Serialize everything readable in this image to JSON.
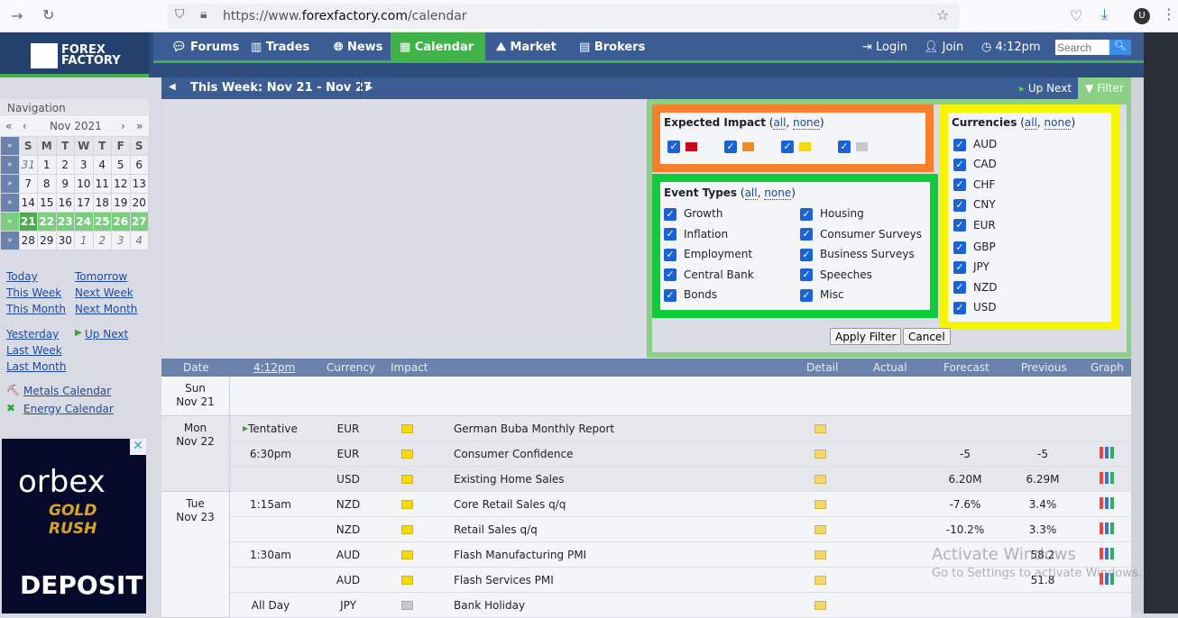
{
  "browser": {
    "url_prefix": "https://www.",
    "url_domain": "forexfactory.com",
    "url_path": "/calendar"
  },
  "header": {
    "logo": "FOREX FACTORY",
    "nav": [
      "Forums",
      "Trades",
      "News",
      "Calendar",
      "Market",
      "Brokers"
    ],
    "active": "Calendar",
    "login": "Login",
    "join": "Join",
    "time": "4:12pm",
    "search_placeholder": "Search"
  },
  "weekbar": {
    "label": "This Week: Nov 21 - Nov 27",
    "up_next": "Up Next",
    "filter": "Filter"
  },
  "sidebar": {
    "title": "Navigation",
    "month": "Nov 2021",
    "days": [
      "S",
      "M",
      "T",
      "W",
      "T",
      "F",
      "S"
    ],
    "weeks": [
      [
        "31",
        "1",
        "2",
        "3",
        "4",
        "5",
        "6"
      ],
      [
        "7",
        "8",
        "9",
        "10",
        "11",
        "12",
        "13"
      ],
      [
        "14",
        "15",
        "16",
        "17",
        "18",
        "19",
        "20"
      ],
      [
        "21",
        "22",
        "23",
        "24",
        "25",
        "26",
        "27"
      ],
      [
        "28",
        "29",
        "30",
        "1",
        "2",
        "3",
        "4"
      ]
    ],
    "links": {
      "today": "Today",
      "tomorrow": "Tomorrow",
      "this_week": "This Week",
      "next_week": "Next Week",
      "this_month": "This Month",
      "next_month": "Next Month",
      "yesterday": "Yesterday",
      "up_next": "Up Next",
      "last_week": "Last Week",
      "last_month": "Last Month",
      "metals": "Metals Calendar",
      "energy": "Energy Calendar"
    }
  },
  "filter": {
    "impact_title": "Expected Impact",
    "all": "all",
    "none": "none",
    "impact_colors": [
      "#d0021b",
      "#f08a24",
      "#f5d90a",
      "#c8c8c8"
    ],
    "event_title": "Event Types",
    "events_left": [
      "Growth",
      "Inflation",
      "Employment",
      "Central Bank",
      "Bonds"
    ],
    "events_right": [
      "Housing",
      "Consumer Surveys",
      "Business Surveys",
      "Speeches",
      "Misc"
    ],
    "currency_title": "Currencies",
    "currencies": [
      "AUD",
      "CAD",
      "CHF",
      "CNY",
      "EUR",
      "GBP",
      "JPY",
      "NZD",
      "USD"
    ],
    "apply": "Apply Filter",
    "cancel": "Cancel"
  },
  "table": {
    "headers": {
      "date": "Date",
      "time": "4:12pm",
      "currency": "Currency",
      "impact": "Impact",
      "detail": "Detail",
      "actual": "Actual",
      "forecast": "Forecast",
      "previous": "Previous",
      "graph": "Graph"
    },
    "days": [
      {
        "day": "Sun",
        "date": "Nov 21"
      },
      {
        "day": "Mon",
        "date": "Nov 22"
      },
      {
        "day": "Tue",
        "date": "Nov 23"
      }
    ],
    "rows": [
      {
        "time": "Tentative",
        "currency": "EUR",
        "impact": "yellow",
        "event": "German Buba Monthly Report",
        "forecast": "",
        "previous": "",
        "graph": false
      },
      {
        "time": "6:30pm",
        "currency": "EUR",
        "impact": "yellow",
        "event": "Consumer Confidence",
        "forecast": "-5",
        "previous": "-5",
        "graph": true
      },
      {
        "time": "",
        "currency": "USD",
        "impact": "yellow",
        "event": "Existing Home Sales",
        "forecast": "6.20M",
        "previous": "6.29M",
        "graph": true
      },
      {
        "time": "1:15am",
        "currency": "NZD",
        "impact": "yellow",
        "event": "Core Retail Sales q/q",
        "forecast": "-7.6%",
        "previous": "3.4%",
        "graph": true
      },
      {
        "time": "",
        "currency": "NZD",
        "impact": "yellow",
        "event": "Retail Sales q/q",
        "forecast": "-10.2%",
        "previous": "3.3%",
        "graph": true
      },
      {
        "time": "1:30am",
        "currency": "AUD",
        "impact": "yellow",
        "event": "Flash Manufacturing PMI",
        "forecast": "",
        "previous": "58.2",
        "graph": true
      },
      {
        "time": "",
        "currency": "AUD",
        "impact": "yellow",
        "event": "Flash Services PMI",
        "forecast": "",
        "previous": "51.8",
        "graph": true
      },
      {
        "time": "All Day",
        "currency": "JPY",
        "impact": "gray",
        "event": "Bank Holiday",
        "forecast": "",
        "previous": "",
        "graph": false
      }
    ]
  },
  "ad": {
    "brand": "orbex",
    "tagline": "GOLD RUSH",
    "cta": "DEPOSIT"
  },
  "watermark": {
    "line1": "Activate Windows",
    "line2": "Go to Settings to activate Windows."
  }
}
